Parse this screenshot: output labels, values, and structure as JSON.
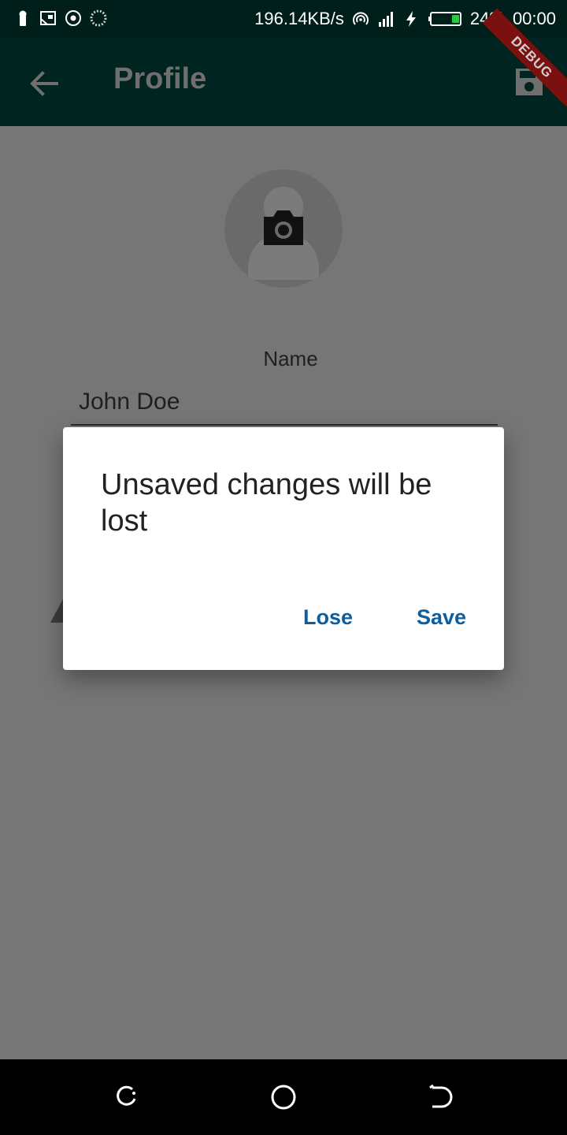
{
  "status_bar": {
    "speed": "196.14KB/s",
    "battery": "24%",
    "time": "00:00",
    "left_icons": [
      "keyhole-icon",
      "cast-icon",
      "target-icon",
      "spinner-icon"
    ],
    "right_icons": [
      "hotspot-icon",
      "signal-icon",
      "charging-icon",
      "battery-icon"
    ]
  },
  "app_bar": {
    "title": "Profile",
    "debug_label": "DEBUG"
  },
  "profile": {
    "name_label": "Name",
    "name_value": "John Doe"
  },
  "dialog": {
    "title": "Unsaved changes will be lost",
    "lose_label": "Lose",
    "save_label": "Save"
  },
  "colors": {
    "appbar": "#00241f",
    "accent": "#0b5fa0",
    "scrim": "#767676"
  }
}
